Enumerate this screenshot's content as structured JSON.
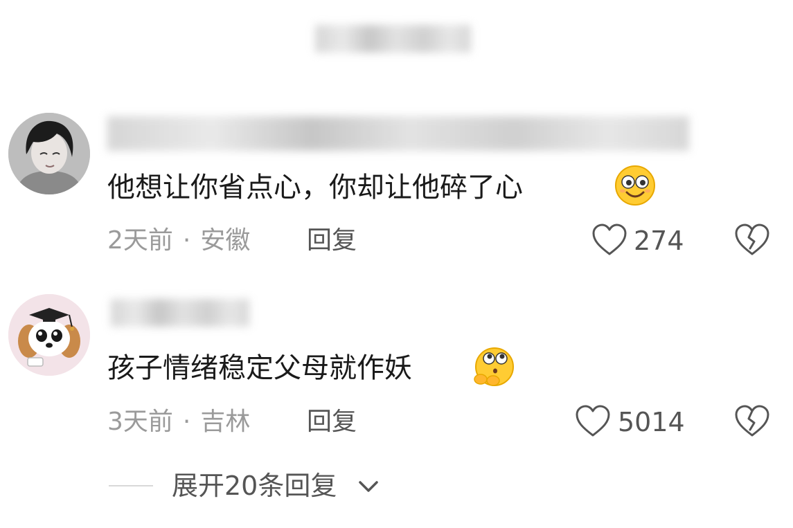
{
  "comments": [
    {
      "text": "他想让你省点心，你却让他碎了心",
      "emoji": "smiling-face-emoji",
      "time": "2天前",
      "location": "安徽",
      "separator": "·",
      "reply_label": "回复",
      "likes": "274"
    },
    {
      "text": "孩子情绪稳定父母就作妖",
      "emoji": "pleading-face-emoji",
      "time": "3天前",
      "location": "吉林",
      "separator": "·",
      "reply_label": "回复",
      "likes": "5014"
    }
  ],
  "expand": {
    "label": "展开20条回复"
  },
  "colors": {
    "text": "#1a1a1a",
    "meta": "#9a9a9a",
    "secondary": "#555555",
    "emoji_yellow": "#ffcc33"
  }
}
